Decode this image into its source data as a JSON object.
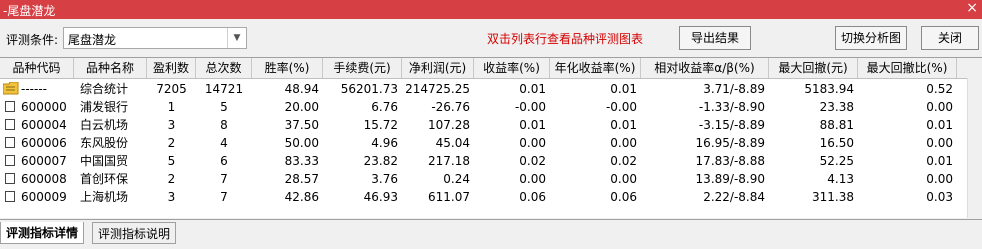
{
  "window": {
    "title": "-尾盘潜龙",
    "close_glyph": "×"
  },
  "toolbar": {
    "condition_label": "评测条件:",
    "condition_value": "尾盘潜龙",
    "hint": "双击列表行查看品种评测图表",
    "export_label": "导出结果",
    "switch_label": "切换分析图",
    "close_label": "关闭"
  },
  "table": {
    "columns": [
      "品种代码",
      "品种名称",
      "盈利数",
      "总次数",
      "胜率(%)",
      "手续费(元)",
      "净利润(元)",
      "收益率(%)",
      "年化收益率(%)",
      "相对收益率α/β(%)",
      "最大回撤(元)",
      "最大回撤比(%)"
    ],
    "summary": {
      "code": "------",
      "name": "综合统计",
      "wins": "7205",
      "total": "14721",
      "winrate": "48.94",
      "fee": "56201.73",
      "profit": "214725.25",
      "ret": "0.01",
      "annual": "0.01",
      "relative": "3.71/-8.89",
      "maxdd": "5183.94",
      "maxddpct": "0.52"
    },
    "rows": [
      {
        "code": "600000",
        "name": "浦发银行",
        "wins": "1",
        "total": "5",
        "winrate": "20.00",
        "fee": "6.76",
        "profit": "-26.76",
        "ret": "-0.00",
        "annual": "-0.00",
        "relative": "-1.33/-8.90",
        "maxdd": "23.38",
        "maxddpct": "0.00"
      },
      {
        "code": "600004",
        "name": "白云机场",
        "wins": "3",
        "total": "8",
        "winrate": "37.50",
        "fee": "15.72",
        "profit": "107.28",
        "ret": "0.01",
        "annual": "0.01",
        "relative": "-3.15/-8.89",
        "maxdd": "88.81",
        "maxddpct": "0.01"
      },
      {
        "code": "600006",
        "name": "东风股份",
        "wins": "2",
        "total": "4",
        "winrate": "50.00",
        "fee": "4.96",
        "profit": "45.04",
        "ret": "0.00",
        "annual": "0.00",
        "relative": "16.95/-8.89",
        "maxdd": "16.50",
        "maxddpct": "0.00"
      },
      {
        "code": "600007",
        "name": "中国国贸",
        "wins": "5",
        "total": "6",
        "winrate": "83.33",
        "fee": "23.82",
        "profit": "217.18",
        "ret": "0.02",
        "annual": "0.02",
        "relative": "17.83/-8.88",
        "maxdd": "52.25",
        "maxddpct": "0.01"
      },
      {
        "code": "600008",
        "name": "首创环保",
        "wins": "2",
        "total": "7",
        "winrate": "28.57",
        "fee": "3.76",
        "profit": "0.24",
        "ret": "0.00",
        "annual": "0.00",
        "relative": "13.89/-8.90",
        "maxdd": "4.13",
        "maxddpct": "0.00"
      },
      {
        "code": "600009",
        "name": "上海机场",
        "wins": "3",
        "total": "7",
        "winrate": "42.86",
        "fee": "46.93",
        "profit": "611.07",
        "ret": "0.06",
        "annual": "0.06",
        "relative": "2.22/-8.84",
        "maxdd": "311.38",
        "maxddpct": "0.03"
      }
    ]
  },
  "tabs": [
    {
      "label": "评测指标详情",
      "active": true
    },
    {
      "label": "评测指标说明",
      "active": false
    }
  ]
}
